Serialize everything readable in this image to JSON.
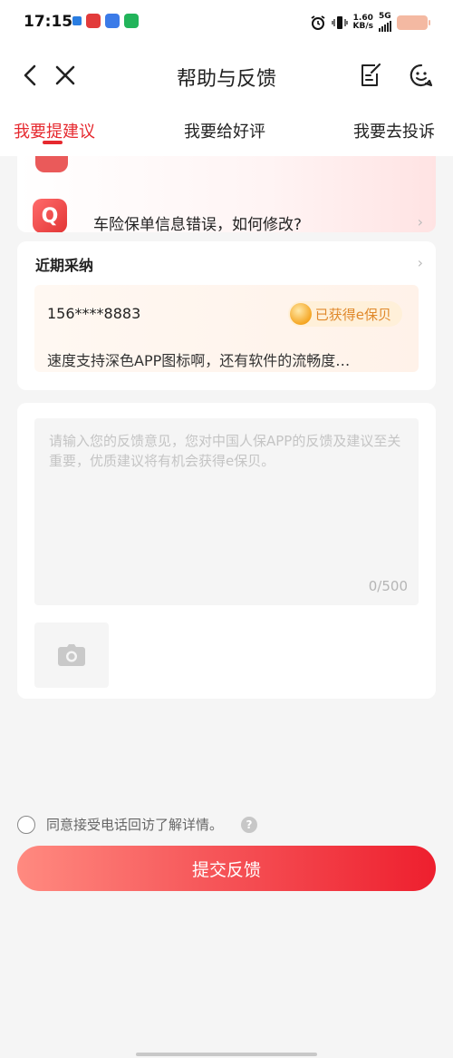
{
  "status_bar": {
    "time": "17:15",
    "net_speed_value": "1.60",
    "net_speed_unit": "KB/s",
    "network": "5G"
  },
  "nav": {
    "title": "帮助与反馈",
    "back_icon": "chevron-left-icon",
    "close_icon": "close-icon",
    "edit_icon": "edit-note-icon",
    "service_icon": "customer-service-icon"
  },
  "tabs": [
    {
      "label": "我要提建议",
      "active": true
    },
    {
      "label": "我要给好评",
      "active": false
    },
    {
      "label": "我要去投诉",
      "active": false
    }
  ],
  "faq": {
    "icon_letter": "Q",
    "question": "车险保单信息错误，如何修改?"
  },
  "adopted": {
    "title": "近期采纳",
    "phone": "156****8883",
    "badge": "已获得e保贝",
    "description": "速度支持深色APP图标啊，还有软件的流畅度…"
  },
  "feedback": {
    "placeholder": "请输入您的反馈意见，您对中国人保APP的反馈及建议至关重要，优质建议将有机会获得e保贝。",
    "value": "",
    "counter": "0/500",
    "photo_icon": "camera-icon"
  },
  "agreement": {
    "label": "同意接受电话回访了解详情。",
    "checked": false,
    "help_icon": "question-mark-icon"
  },
  "submit": {
    "label": "提交反馈"
  },
  "colors": {
    "accent": "#e6292f",
    "badge_text": "#e0892b",
    "page_bg": "#f5f5f5"
  }
}
